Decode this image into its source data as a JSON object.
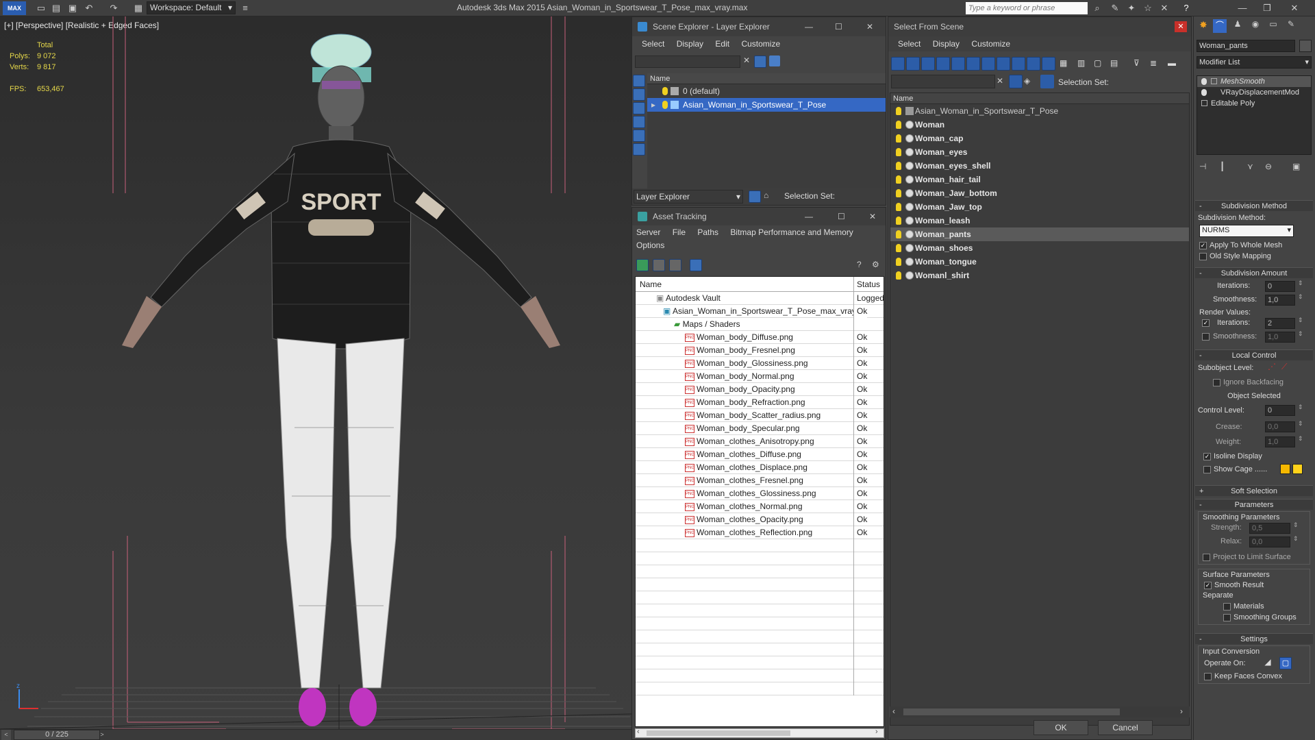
{
  "app": {
    "title": "Autodesk 3ds Max  2015     Asian_Woman_in_Sportswear_T_Pose_max_vray.max",
    "workspace": "Workspace: Default",
    "search_placeholder": "Type a keyword or phrase"
  },
  "viewport": {
    "label": "[+] [Perspective] [Realistic + Edged Faces]",
    "total_label": "Total",
    "polys_label": "Polys:",
    "polys": "9 072",
    "verts_label": "Verts:",
    "verts": "9 817",
    "fps_label": "FPS:",
    "fps": "653,467",
    "timeline": "0 / 225",
    "shirt_text": "SPORT"
  },
  "scene_explorer": {
    "title": "Scene Explorer - Layer Explorer",
    "menu": [
      "Select",
      "Display",
      "Edit",
      "Customize"
    ],
    "col_name": "Name",
    "layers": [
      "0 (default)",
      "Asian_Woman_in_Sportswear_T_Pose"
    ],
    "footer_dropdown": "Layer Explorer",
    "selection_set": "Selection Set:"
  },
  "asset_tracking": {
    "title": "Asset Tracking",
    "menu": [
      "Server",
      "File",
      "Paths",
      "Bitmap Performance and Memory"
    ],
    "menu2": "Options",
    "col_name": "Name",
    "col_status": "Status",
    "vault": "Autodesk Vault",
    "vault_status": "Logged",
    "file": "Asian_Woman_in_Sportswear_T_Pose_max_vray...",
    "file_status": "Ok",
    "maps": "Maps / Shaders",
    "items": [
      "Woman_body_Diffuse.png",
      "Woman_body_Fresnel.png",
      "Woman_body_Glossiness.png",
      "Woman_body_Normal.png",
      "Woman_body_Opacity.png",
      "Woman_body_Refraction.png",
      "Woman_body_Scatter_radius.png",
      "Woman_body_Specular.png",
      "Woman_clothes_Anisotropy.png",
      "Woman_clothes_Diffuse.png",
      "Woman_clothes_Displace.png",
      "Woman_clothes_Fresnel.png",
      "Woman_clothes_Glossiness.png",
      "Woman_clothes_Normal.png",
      "Woman_clothes_Opacity.png",
      "Woman_clothes_Reflection.png"
    ],
    "item_status": "Ok"
  },
  "select_from_scene": {
    "title": "Select From Scene",
    "menu": [
      "Select",
      "Display",
      "Customize"
    ],
    "selection_set": "Selection Set:",
    "col_name": "Name",
    "root": "Asian_Woman_in_Sportswear_T_Pose",
    "objects": [
      "Woman",
      "Woman_cap",
      "Woman_eyes",
      "Woman_eyes_shell",
      "Woman_hair_tail",
      "Woman_Jaw_bottom",
      "Woman_Jaw_top",
      "Woman_leash",
      "Woman_pants",
      "Woman_shoes",
      "Woman_tongue",
      "Womanl_shirt"
    ],
    "selected": "Woman_pants",
    "ok": "OK",
    "cancel": "Cancel"
  },
  "modify_panel": {
    "object_name": "Woman_pants",
    "modifier_list": "Modifier List",
    "stack": [
      "MeshSmooth",
      "VRayDisplacementMod",
      "Editable Poly"
    ],
    "subdivision_method_hdr": "Subdivision Method",
    "subdivision_method_lbl": "Subdivision Method:",
    "subdivision_method_val": "NURMS",
    "apply_whole_mesh": "Apply To Whole Mesh",
    "old_style_mapping": "Old Style Mapping",
    "subdivision_amount_hdr": "Subdivision Amount",
    "iterations_lbl": "Iterations:",
    "iterations_val": "0",
    "smoothness_lbl": "Smoothness:",
    "smoothness_val": "1,0",
    "render_values": "Render Values:",
    "r_iterations_val": "2",
    "r_smoothness_val": "1,0",
    "local_control_hdr": "Local Control",
    "subobject_level": "Subobject Level:",
    "ignore_backfacing": "Ignore Backfacing",
    "object_selected": "Object Selected",
    "control_level_lbl": "Control Level:",
    "control_level_val": "0",
    "crease_lbl": "Crease:",
    "crease_val": "0,0",
    "weight_lbl": "Weight:",
    "weight_val": "1,0",
    "isoline_display": "Isoline Display",
    "show_cage": "Show Cage ......",
    "soft_selection_hdr": "Soft Selection",
    "parameters_hdr": "Parameters",
    "smoothing_params": "Smoothing Parameters",
    "strength_lbl": "Strength:",
    "strength_val": "0,5",
    "relax_lbl": "Relax:",
    "relax_val": "0,0",
    "project_limit": "Project to Limit Surface",
    "surface_params": "Surface Parameters",
    "smooth_result": "Smooth Result",
    "separate": "Separate",
    "materials": "Materials",
    "smoothing_groups": "Smoothing Groups",
    "settings_hdr": "Settings",
    "input_conversion": "Input Conversion",
    "operate_on": "Operate On:",
    "keep_faces_convex": "Keep Faces Convex"
  },
  "colors": {
    "selection_blue": "#3568c4",
    "viewport_bg": "#333333",
    "bulb_yellow": "#f0d020",
    "cage_color_1": "#f5b800",
    "cage_color_2": "#ffd21a"
  }
}
